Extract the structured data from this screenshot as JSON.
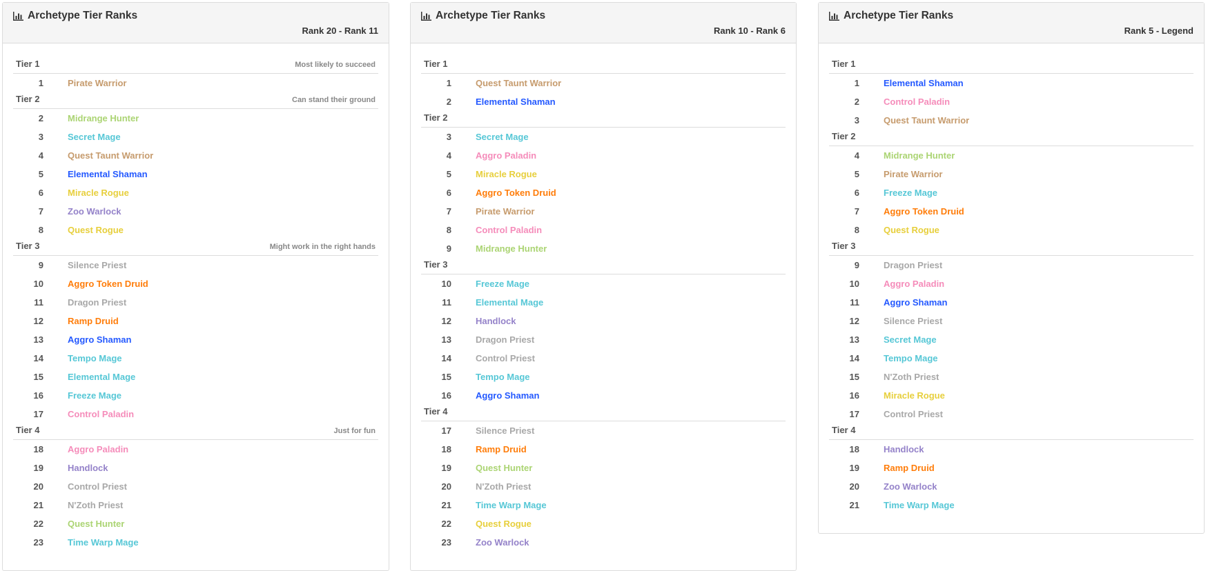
{
  "colors": {
    "Warrior": "#c69b6d",
    "Hunter": "#abd473",
    "Mage": "#56c7d6",
    "Shaman": "#2459ff",
    "Rogue": "#e7cf3c",
    "Warlock": "#9482c9",
    "Priest": "#a8a8a8",
    "Druid": "#ff7d0a",
    "Paladin": "#f58cba"
  },
  "panels": [
    {
      "title": "Archetype Tier Ranks",
      "range": "Rank 20 - Rank 11",
      "tiers": [
        {
          "label": "Tier 1",
          "desc": "Most likely to succeed",
          "rows": [
            {
              "rank": "1",
              "name": "Pirate Warrior",
              "cls": "Warrior"
            }
          ]
        },
        {
          "label": "Tier 2",
          "desc": "Can stand their ground",
          "rows": [
            {
              "rank": "2",
              "name": "Midrange Hunter",
              "cls": "Hunter"
            },
            {
              "rank": "3",
              "name": "Secret Mage",
              "cls": "Mage"
            },
            {
              "rank": "4",
              "name": "Quest Taunt Warrior",
              "cls": "Warrior"
            },
            {
              "rank": "5",
              "name": "Elemental Shaman",
              "cls": "Shaman"
            },
            {
              "rank": "6",
              "name": "Miracle Rogue",
              "cls": "Rogue"
            },
            {
              "rank": "7",
              "name": "Zoo Warlock",
              "cls": "Warlock"
            },
            {
              "rank": "8",
              "name": "Quest Rogue",
              "cls": "Rogue"
            }
          ]
        },
        {
          "label": "Tier 3",
          "desc": "Might work in the right hands",
          "rows": [
            {
              "rank": "9",
              "name": "Silence Priest",
              "cls": "Priest"
            },
            {
              "rank": "10",
              "name": "Aggro Token Druid",
              "cls": "Druid"
            },
            {
              "rank": "11",
              "name": "Dragon Priest",
              "cls": "Priest"
            },
            {
              "rank": "12",
              "name": "Ramp Druid",
              "cls": "Druid"
            },
            {
              "rank": "13",
              "name": "Aggro Shaman",
              "cls": "Shaman"
            },
            {
              "rank": "14",
              "name": "Tempo Mage",
              "cls": "Mage"
            },
            {
              "rank": "15",
              "name": "Elemental Mage",
              "cls": "Mage"
            },
            {
              "rank": "16",
              "name": "Freeze Mage",
              "cls": "Mage"
            },
            {
              "rank": "17",
              "name": "Control Paladin",
              "cls": "Paladin"
            }
          ]
        },
        {
          "label": "Tier 4",
          "desc": "Just for fun",
          "rows": [
            {
              "rank": "18",
              "name": "Aggro Paladin",
              "cls": "Paladin"
            },
            {
              "rank": "19",
              "name": "Handlock",
              "cls": "Warlock"
            },
            {
              "rank": "20",
              "name": "Control Priest",
              "cls": "Priest"
            },
            {
              "rank": "21",
              "name": "N'Zoth Priest",
              "cls": "Priest"
            },
            {
              "rank": "22",
              "name": "Quest Hunter",
              "cls": "Hunter"
            },
            {
              "rank": "23",
              "name": "Time Warp Mage",
              "cls": "Mage"
            }
          ]
        }
      ]
    },
    {
      "title": "Archetype Tier Ranks",
      "range": "Rank 10 - Rank 6",
      "tiers": [
        {
          "label": "Tier 1",
          "desc": "",
          "rows": [
            {
              "rank": "1",
              "name": "Quest Taunt Warrior",
              "cls": "Warrior"
            },
            {
              "rank": "2",
              "name": "Elemental Shaman",
              "cls": "Shaman"
            }
          ]
        },
        {
          "label": "Tier 2",
          "desc": "",
          "rows": [
            {
              "rank": "3",
              "name": "Secret Mage",
              "cls": "Mage"
            },
            {
              "rank": "4",
              "name": "Aggro Paladin",
              "cls": "Paladin"
            },
            {
              "rank": "5",
              "name": "Miracle Rogue",
              "cls": "Rogue"
            },
            {
              "rank": "6",
              "name": "Aggro Token Druid",
              "cls": "Druid"
            },
            {
              "rank": "7",
              "name": "Pirate Warrior",
              "cls": "Warrior"
            },
            {
              "rank": "8",
              "name": "Control Paladin",
              "cls": "Paladin"
            },
            {
              "rank": "9",
              "name": "Midrange Hunter",
              "cls": "Hunter"
            }
          ]
        },
        {
          "label": "Tier 3",
          "desc": "",
          "rows": [
            {
              "rank": "10",
              "name": "Freeze Mage",
              "cls": "Mage"
            },
            {
              "rank": "11",
              "name": "Elemental Mage",
              "cls": "Mage"
            },
            {
              "rank": "12",
              "name": "Handlock",
              "cls": "Warlock"
            },
            {
              "rank": "13",
              "name": "Dragon Priest",
              "cls": "Priest"
            },
            {
              "rank": "14",
              "name": "Control Priest",
              "cls": "Priest"
            },
            {
              "rank": "15",
              "name": "Tempo Mage",
              "cls": "Mage"
            },
            {
              "rank": "16",
              "name": "Aggro Shaman",
              "cls": "Shaman"
            }
          ]
        },
        {
          "label": "Tier 4",
          "desc": "",
          "rows": [
            {
              "rank": "17",
              "name": "Silence Priest",
              "cls": "Priest"
            },
            {
              "rank": "18",
              "name": "Ramp Druid",
              "cls": "Druid"
            },
            {
              "rank": "19",
              "name": "Quest Hunter",
              "cls": "Hunter"
            },
            {
              "rank": "20",
              "name": "N'Zoth Priest",
              "cls": "Priest"
            },
            {
              "rank": "21",
              "name": "Time Warp Mage",
              "cls": "Mage"
            },
            {
              "rank": "22",
              "name": "Quest Rogue",
              "cls": "Rogue"
            },
            {
              "rank": "23",
              "name": "Zoo Warlock",
              "cls": "Warlock"
            }
          ]
        }
      ]
    },
    {
      "title": "Archetype Tier Ranks",
      "range": "Rank 5 - Legend",
      "tiers": [
        {
          "label": "Tier 1",
          "desc": "",
          "rows": [
            {
              "rank": "1",
              "name": "Elemental Shaman",
              "cls": "Shaman"
            },
            {
              "rank": "2",
              "name": "Control Paladin",
              "cls": "Paladin"
            },
            {
              "rank": "3",
              "name": "Quest Taunt Warrior",
              "cls": "Warrior"
            }
          ]
        },
        {
          "label": "Tier 2",
          "desc": "",
          "rows": [
            {
              "rank": "4",
              "name": "Midrange Hunter",
              "cls": "Hunter"
            },
            {
              "rank": "5",
              "name": "Pirate Warrior",
              "cls": "Warrior"
            },
            {
              "rank": "6",
              "name": "Freeze Mage",
              "cls": "Mage"
            },
            {
              "rank": "7",
              "name": "Aggro Token Druid",
              "cls": "Druid"
            },
            {
              "rank": "8",
              "name": "Quest Rogue",
              "cls": "Rogue"
            }
          ]
        },
        {
          "label": "Tier 3",
          "desc": "",
          "rows": [
            {
              "rank": "9",
              "name": "Dragon Priest",
              "cls": "Priest"
            },
            {
              "rank": "10",
              "name": "Aggro Paladin",
              "cls": "Paladin"
            },
            {
              "rank": "11",
              "name": "Aggro Shaman",
              "cls": "Shaman"
            },
            {
              "rank": "12",
              "name": "Silence Priest",
              "cls": "Priest"
            },
            {
              "rank": "13",
              "name": "Secret Mage",
              "cls": "Mage"
            },
            {
              "rank": "14",
              "name": "Tempo Mage",
              "cls": "Mage"
            },
            {
              "rank": "15",
              "name": "N'Zoth Priest",
              "cls": "Priest"
            },
            {
              "rank": "16",
              "name": "Miracle Rogue",
              "cls": "Rogue"
            },
            {
              "rank": "17",
              "name": "Control Priest",
              "cls": "Priest"
            }
          ]
        },
        {
          "label": "Tier 4",
          "desc": "",
          "rows": [
            {
              "rank": "18",
              "name": "Handlock",
              "cls": "Warlock"
            },
            {
              "rank": "19",
              "name": "Ramp Druid",
              "cls": "Druid"
            },
            {
              "rank": "20",
              "name": "Zoo Warlock",
              "cls": "Warlock"
            },
            {
              "rank": "21",
              "name": "Time Warp Mage",
              "cls": "Mage"
            }
          ]
        }
      ]
    }
  ]
}
